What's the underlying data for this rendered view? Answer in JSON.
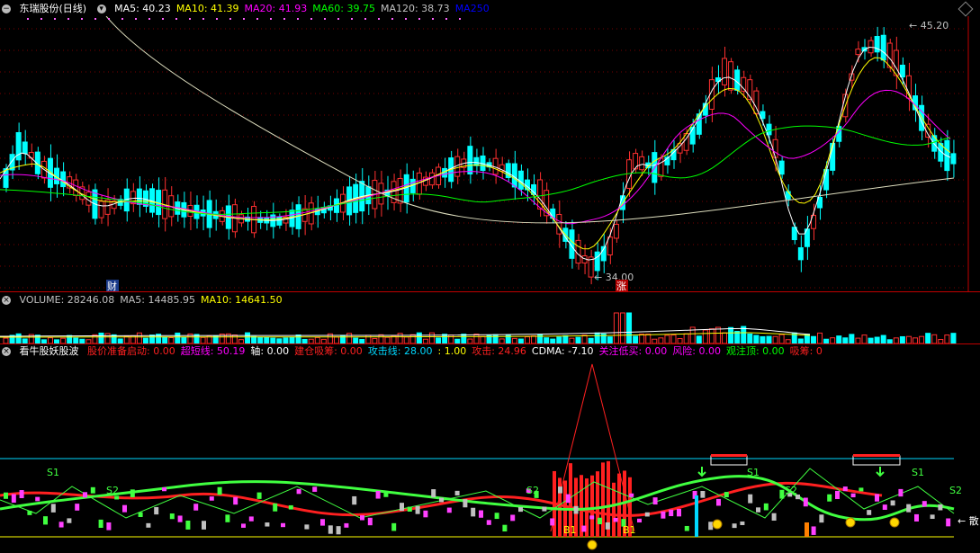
{
  "price_panel": {
    "title": "东瑞股份(日线)",
    "ma": [
      {
        "label": "MA5: 40.23",
        "color": "#ffffff"
      },
      {
        "label": "MA10: 41.39",
        "color": "#ffff00"
      },
      {
        "label": "MA20: 41.93",
        "color": "#ff00ff"
      },
      {
        "label": "MA60: 39.75",
        "color": "#00ff00"
      },
      {
        "label": "MA120: 38.73",
        "color": "#c0c0c0"
      },
      {
        "label": "MA250",
        "color": "#0000ff"
      }
    ],
    "high_label": "45.20",
    "low_label": "34.00",
    "marker_cai": "财",
    "marker_zhang": "涨"
  },
  "volume_panel": {
    "items": [
      {
        "label": "VOLUME: 28246.08",
        "color": "#c0c0c0"
      },
      {
        "label": "MA5: 14485.95",
        "color": "#c0c0c0"
      },
      {
        "label": "MA10: 14641.50",
        "color": "#ffff00"
      }
    ]
  },
  "indicator_panel": {
    "title": "看牛股妖股波",
    "items": [
      {
        "label": "股价准备启动: 0.00",
        "color": "#ff2020"
      },
      {
        "label": "超短线: 50.19",
        "color": "#ff00ff"
      },
      {
        "label": "轴: 0.00",
        "color": "#ffffff"
      },
      {
        "label": "建仓吸筹: 0.00",
        "color": "#ff2020"
      },
      {
        "label": "攻击线: 28.00",
        "color": "#00d8ff"
      },
      {
        "label": ": 1.00",
        "color": "#ffff00"
      },
      {
        "label": "攻击: 24.96",
        "color": "#ff2020"
      },
      {
        "label": "CDMA: -7.10",
        "color": "#ffffff"
      },
      {
        "label": "关注低买: 0.00",
        "color": "#ff00ff"
      },
      {
        "label": "风险: 0.00",
        "color": "#ff00ff"
      },
      {
        "label": "观注顶: 0.00",
        "color": "#00ff00"
      },
      {
        "label": "吸筹: 0",
        "color": "#ff2020"
      }
    ],
    "label_s1": "S1",
    "label_s2": "S2",
    "label_b1": "B1",
    "label_san": "散"
  },
  "colors": {
    "up": "#ff3030",
    "down": "#00ffff",
    "divider": "#c00000"
  }
}
